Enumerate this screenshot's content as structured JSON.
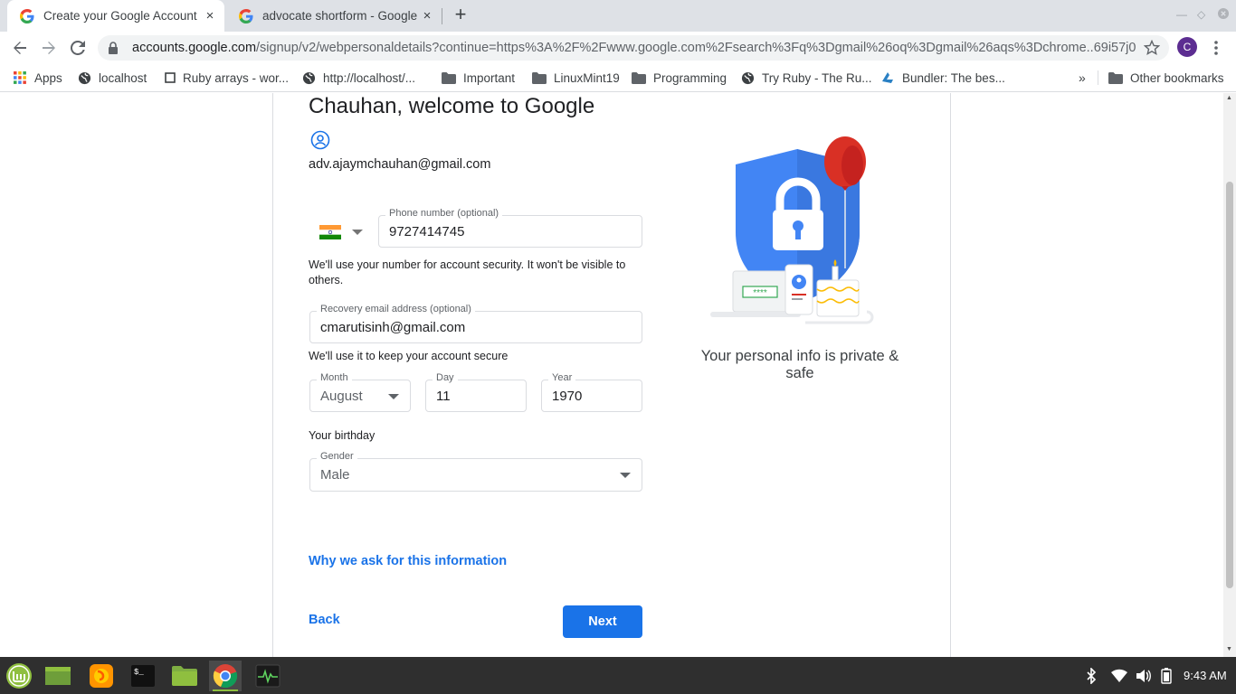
{
  "browser": {
    "tabs": [
      {
        "title": "Create your Google Account",
        "close": "×"
      },
      {
        "title": "advocate shortform - Google",
        "close": "×"
      }
    ],
    "new_tab": "+",
    "url_host": "accounts.google.com",
    "url_rest": "/signup/v2/webpersonaldetails?continue=https%3A%2F%2Fwww.google.com%2Fsearch%3Fq%3Dgmail%26oq%3Dgmail%26aqs%3Dchrome..69i57j0l...",
    "profile_initial": "C"
  },
  "bookmarks": {
    "items": [
      "Apps",
      "localhost",
      "Ruby arrays - wor...",
      "http://localhost/...",
      "Important",
      "LinuxMint19",
      "Programming",
      "Try Ruby - The Ru...",
      "Bundler: The bes...",
      "Other bookmarks"
    ],
    "overflow": "»"
  },
  "form": {
    "heading": "Chauhan, welcome to Google",
    "account_email": "adv.ajaymchauhan@gmail.com",
    "phone": {
      "label": "Phone number (optional)",
      "value": "9727414745"
    },
    "phone_hint": "We'll use your number for account security. It won't be visible to others.",
    "recovery": {
      "label": "Recovery email address (optional)",
      "value": "cmarutisinh@gmail.com"
    },
    "recovery_hint": "We'll use it to keep your account secure",
    "month": {
      "label": "Month",
      "value": "August"
    },
    "day": {
      "label": "Day",
      "value": "11"
    },
    "year": {
      "label": "Year",
      "value": "1970"
    },
    "birthday_hint": "Your birthday",
    "gender": {
      "label": "Gender",
      "value": "Male"
    },
    "why_link": "Why we ask for this information",
    "back": "Back",
    "next": "Next"
  },
  "illustration": {
    "caption": "Your personal info is private & safe",
    "password_mask": "****"
  },
  "taskbar": {
    "clock": "9:43 AM"
  },
  "colors": {
    "accent": "#1a73e8",
    "shield": "#4285f4",
    "balloon": "#d93025"
  }
}
